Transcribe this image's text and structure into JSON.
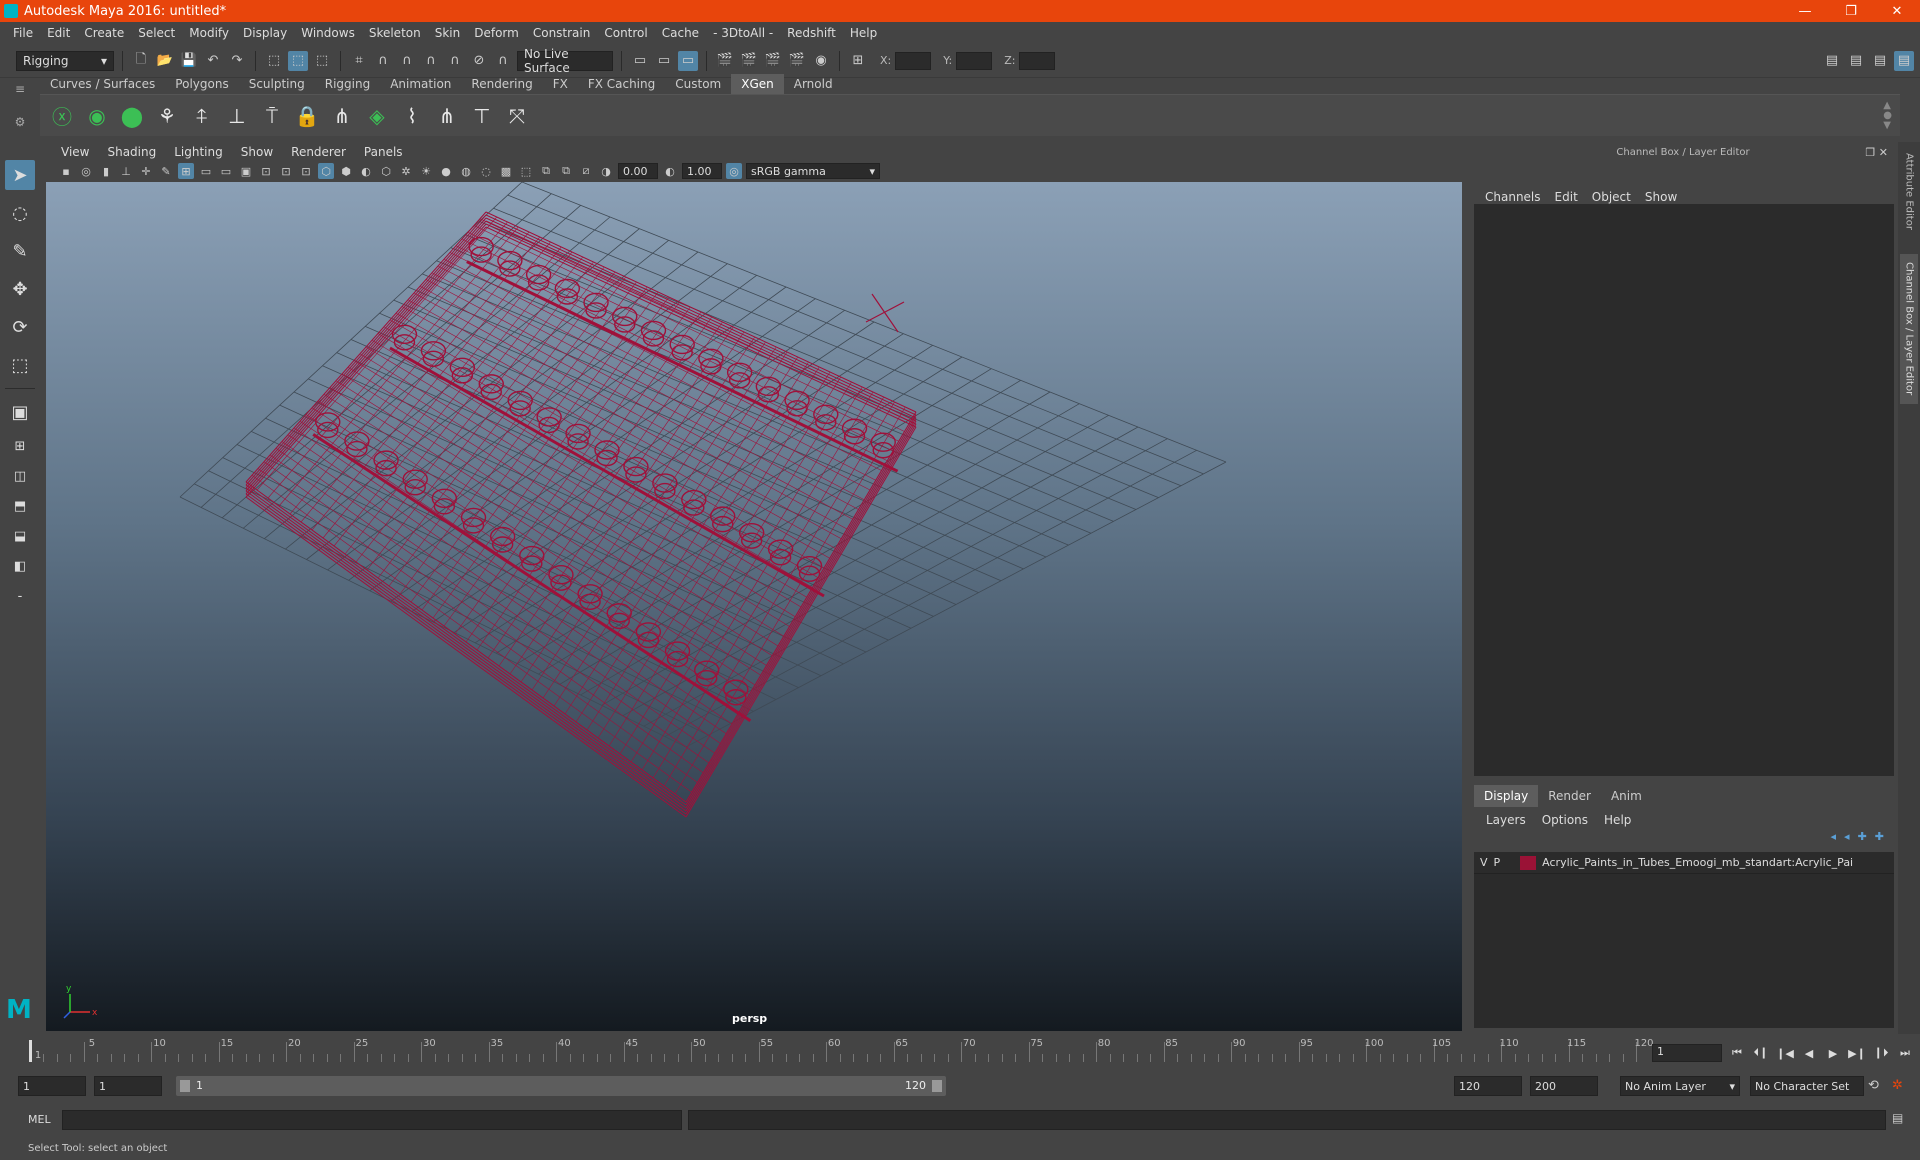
{
  "window": {
    "title": "Autodesk Maya 2016: untitled*",
    "controls": [
      "—",
      "❐",
      "✕"
    ]
  },
  "menubar": {
    "items": [
      "File",
      "Edit",
      "Create",
      "Select",
      "Modify",
      "Display",
      "Windows",
      "Skeleton",
      "Skin",
      "Deform",
      "Constrain",
      "Control",
      "Cache",
      "- 3DtoAll -",
      "Redshift",
      "Help"
    ]
  },
  "statusline": {
    "menuset": "Rigging",
    "live_surface": "No Live Surface",
    "coord_labels": [
      "X:",
      "Y:",
      "Z:"
    ]
  },
  "shelf": {
    "tabs": [
      "Curves / Surfaces",
      "Polygons",
      "Sculpting",
      "Rigging",
      "Animation",
      "Rendering",
      "FX",
      "FX Caching",
      "Custom",
      "XGen",
      "Arnold"
    ],
    "active_tab": "XGen"
  },
  "viewport": {
    "menu": [
      "View",
      "Shading",
      "Lighting",
      "Show",
      "Renderer",
      "Panels"
    ],
    "exposure": "0.00",
    "gamma": "1.00",
    "color_space": "sRGB gamma",
    "camera": "persp",
    "wire_color": "#a0103a",
    "axis_labels": [
      "x",
      "y"
    ]
  },
  "channelbox": {
    "title": "Channel Box / Layer Editor",
    "menu": [
      "Channels",
      "Edit",
      "Object",
      "Show"
    ],
    "layer_tabs": [
      "Display",
      "Render",
      "Anim"
    ],
    "layer_menu": [
      "Layers",
      "Options",
      "Help"
    ],
    "layers": [
      {
        "v": "V",
        "p": "P",
        "name": "Acrylic_Paints_in_Tubes_Emoogi_mb_standart:Acrylic_Pai",
        "color": "#9a1236"
      }
    ]
  },
  "side_tabs": [
    "Attribute Editor",
    "Channel Box / Layer Editor"
  ],
  "timeslider": {
    "ticks": [
      1,
      5,
      10,
      15,
      20,
      25,
      30,
      35,
      40,
      45,
      50,
      55,
      60,
      65,
      70,
      75,
      80,
      85,
      90,
      95,
      100,
      105,
      110,
      115,
      120
    ],
    "current_frame": "1",
    "playback_icons": [
      "⏮",
      "⏴❙",
      "❙◀",
      "◀",
      "▶",
      "▶❙",
      "❙⏵",
      "⏭"
    ]
  },
  "range": {
    "start": "1",
    "playback_start": "1",
    "slider_start": "1",
    "slider_end": "120",
    "playback_end": "120",
    "end": "200",
    "anim_layer": "No Anim Layer",
    "character_set": "No Character Set"
  },
  "cmdline": {
    "label": "MEL"
  },
  "help": {
    "text": "Select Tool: select an object"
  }
}
